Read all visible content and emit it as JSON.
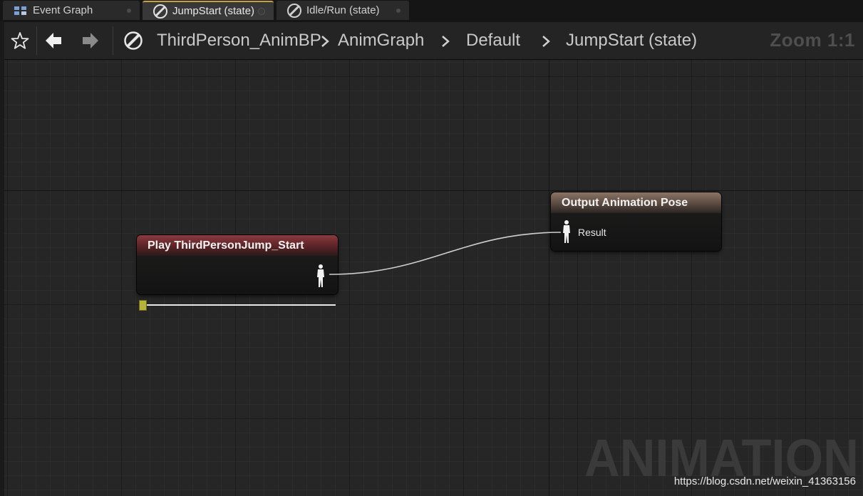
{
  "tabs": [
    {
      "label": "Event Graph",
      "icon": "event-graph-icon",
      "active": false
    },
    {
      "label": "JumpStart (state)",
      "icon": "state-icon",
      "active": true
    },
    {
      "label": "Idle/Run (state)",
      "icon": "state-icon",
      "active": false
    }
  ],
  "toolbar": {
    "favorite_icon": "star-icon",
    "back_icon": "arrow-left-icon",
    "forward_icon": "arrow-right-icon"
  },
  "breadcrumb": {
    "items": [
      "ThirdPerson_AnimBP",
      "AnimGraph",
      "Default",
      "JumpStart (state)"
    ],
    "separator_icon": "chevron-right-icon"
  },
  "zoom": {
    "label": "Zoom 1:1"
  },
  "nodes": {
    "play": {
      "title": "Play ThirdPersonJump_Start",
      "header_color": "#8a3a3e",
      "output_pin_icon": "pose-pin-icon"
    },
    "output": {
      "title": "Output Animation Pose",
      "header_color": "#8a7465",
      "input_pin_label": "Result",
      "input_pin_icon": "pose-pin-icon"
    }
  },
  "playback": {
    "position": 0
  },
  "watermark": {
    "text": "ANIMATION"
  },
  "credit": {
    "text": "https://blog.csdn.net/weixin_41363156"
  },
  "colors": {
    "accent": "#c8a23a",
    "canvas": "#262626",
    "wire": "#cfcfcf",
    "slider_handle": "#b8b43a"
  }
}
